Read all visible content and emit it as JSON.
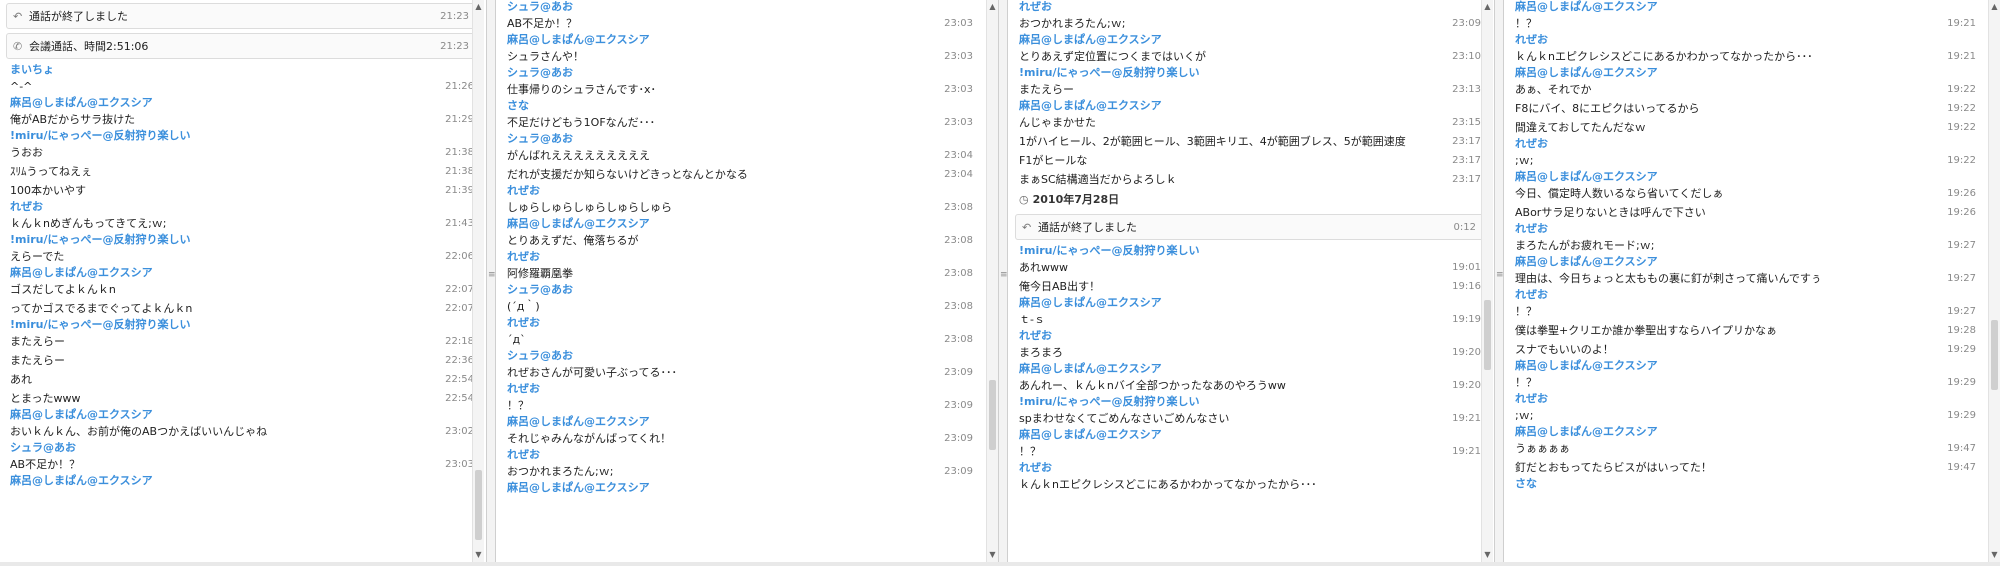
{
  "icons": {
    "call_end": "call-end-icon (handset)",
    "call": "phone-icon",
    "clock": "clock-icon",
    "splitter": "splitter-grip-icon"
  },
  "colors": {
    "name": "#3b8fdc",
    "time": "#8a8a8a",
    "text": "#1e1e1e"
  },
  "columns": [
    {
      "items": [
        {
          "type": "call",
          "icon": "↶",
          "text": "通話が終了しました",
          "time": "21:23"
        },
        {
          "type": "call",
          "icon": "✆",
          "text": "会議通話、時間2:51:06",
          "time": "21:23"
        },
        {
          "type": "msg",
          "name": "まいちょ",
          "lines": [
            {
              "text": "^-^",
              "time": "21:26"
            }
          ]
        },
        {
          "type": "msg",
          "name": "麻呂@しまぱん@エクスシア",
          "lines": [
            {
              "text": "俺がABだからサラ抜けた",
              "time": "21:29"
            }
          ]
        },
        {
          "type": "msg",
          "name": "!miru/にゃっぺー@反射狩り楽しい",
          "lines": [
            {
              "text": "うおお",
              "time": "21:38"
            },
            {
              "text": "ｽﾘﾑうってねえぇ",
              "time": "21:38"
            },
            {
              "text": "100本かいやす",
              "time": "21:39"
            }
          ]
        },
        {
          "type": "msg",
          "name": "れぜお",
          "lines": [
            {
              "text": "ｋんｋnめぎんもってきてえ;ｗ;",
              "time": "21:43"
            }
          ]
        },
        {
          "type": "msg",
          "name": "!miru/にゃっぺー@反射狩り楽しい",
          "lines": [
            {
              "text": "えらーでた",
              "time": "22:06"
            }
          ]
        },
        {
          "type": "msg",
          "name": "麻呂@しまぱん@エクスシア",
          "lines": [
            {
              "text": "ゴスだしてよｋんｋn",
              "time": "22:07"
            },
            {
              "text": "ってかゴスでるまでぐってよｋんｋn",
              "time": "22:07"
            }
          ]
        },
        {
          "type": "msg",
          "name": "!miru/にゃっぺー@反射狩り楽しい",
          "lines": [
            {
              "text": "またえらー",
              "time": "22:18"
            },
            {
              "text": "またえらー",
              "time": "22:36"
            },
            {
              "text": "あれ",
              "time": "22:54"
            },
            {
              "text": "とまったwww",
              "time": "22:54"
            }
          ]
        },
        {
          "type": "msg",
          "name": "麻呂@しまぱん@エクスシア",
          "lines": [
            {
              "text": "おいｋんｋん、お前が俺のABつかえばいいんじゃね",
              "time": "23:02"
            }
          ]
        },
        {
          "type": "msg",
          "name": "シュラ@あお",
          "lines": [
            {
              "text": "AB不足か！？",
              "time": "23:03"
            }
          ]
        },
        {
          "type": "msg",
          "name": "麻呂@しまぱん@エクスシア",
          "lines": []
        }
      ]
    },
    {
      "items": [
        {
          "type": "msg",
          "name": "シュラ@あお",
          "lines": [
            {
              "text": "AB不足か！？",
              "time": "23:03"
            }
          ]
        },
        {
          "type": "msg",
          "name": "麻呂@しまぱん@エクスシア",
          "lines": [
            {
              "text": "シュラさんや！",
              "time": "23:03"
            }
          ]
        },
        {
          "type": "msg",
          "name": "シュラ@あお",
          "lines": [
            {
              "text": "仕事帰りのシュラさんです･x･",
              "time": "23:03"
            }
          ]
        },
        {
          "type": "msg",
          "name": "さな",
          "lines": [
            {
              "text": "不足だけどもう1OFなんだ･･･",
              "time": "23:03"
            }
          ]
        },
        {
          "type": "msg",
          "name": "シュラ@あお",
          "lines": [
            {
              "text": "がんばれえええええええええ",
              "time": "23:04"
            },
            {
              "text": "だれが支援だか知らないけどきっとなんとかなる",
              "time": "23:04"
            }
          ]
        },
        {
          "type": "msg",
          "name": "れぜお",
          "lines": [
            {
              "text": "しゅらしゅらしゅらしゅらしゅら",
              "time": "23:08"
            }
          ]
        },
        {
          "type": "msg",
          "name": "麻呂@しまぱん@エクスシア",
          "lines": [
            {
              "text": "とりあえずだ、俺落ちるが",
              "time": "23:08"
            }
          ]
        },
        {
          "type": "msg",
          "name": "れぜお",
          "lines": [
            {
              "text": "阿修羅覇凰拳",
              "time": "23:08"
            }
          ]
        },
        {
          "type": "msg",
          "name": "シュラ@あお",
          "lines": [
            {
              "text": "(´д｀)",
              "time": "23:08"
            }
          ]
        },
        {
          "type": "msg",
          "name": "れぜお",
          "lines": [
            {
              "text": "´д`",
              "time": "23:08"
            }
          ]
        },
        {
          "type": "msg",
          "name": "シュラ@あお",
          "lines": [
            {
              "text": "れぜおさんが可愛い子ぶってる･･･",
              "time": "23:09"
            }
          ]
        },
        {
          "type": "msg",
          "name": "れぜお",
          "lines": [
            {
              "text": "！？",
              "time": "23:09"
            }
          ]
        },
        {
          "type": "msg",
          "name": "麻呂@しまぱん@エクスシア",
          "lines": [
            {
              "text": "それじゃみんながんばってくれ！",
              "time": "23:09"
            }
          ]
        },
        {
          "type": "msg",
          "name": "れぜお",
          "lines": [
            {
              "text": "おつかれまろたん;ｗ;",
              "time": "23:09"
            }
          ]
        },
        {
          "type": "msg",
          "name": "麻呂@しまぱん@エクスシア",
          "lines": []
        }
      ]
    },
    {
      "items": [
        {
          "type": "msg",
          "name": "れぜお",
          "lines": [
            {
              "text": "おつかれまろたん;ｗ;",
              "time": "23:09"
            }
          ]
        },
        {
          "type": "msg",
          "name": "麻呂@しまぱん@エクスシア",
          "lines": [
            {
              "text": "とりあえず定位置につくまではいくが",
              "time": "23:10"
            }
          ]
        },
        {
          "type": "msg",
          "name": "!miru/にゃっぺー@反射狩り楽しい",
          "lines": [
            {
              "text": "またえらー",
              "time": "23:13"
            }
          ]
        },
        {
          "type": "msg",
          "name": "麻呂@しまぱん@エクスシア",
          "lines": [
            {
              "text": "んじゃまかせた",
              "time": "23:15"
            },
            {
              "text": "1がハイヒール、2が範囲ヒール、3範囲キリエ、4が範囲ブレス、5が範囲速度",
              "time": "23:17"
            },
            {
              "text": "F1がヒールな",
              "time": "23:17"
            },
            {
              "text": "まぁSC結構適当だからよろしｋ",
              "time": "23:17"
            }
          ]
        },
        {
          "type": "date",
          "icon": "◷",
          "text": "2010年7月28日"
        },
        {
          "type": "call",
          "icon": "↶",
          "text": "通話が終了しました",
          "time": "0:12"
        },
        {
          "type": "msg",
          "name": "!miru/にゃっぺー@反射狩り楽しい",
          "lines": [
            {
              "text": "あれwww",
              "time": "19:01"
            },
            {
              "text": "俺今日AB出す！",
              "time": "19:16"
            }
          ]
        },
        {
          "type": "msg",
          "name": "麻呂@しまぱん@エクスシア",
          "lines": [
            {
              "text": "ｔ-ｓ",
              "time": "19:19"
            }
          ]
        },
        {
          "type": "msg",
          "name": "れぜお",
          "lines": [
            {
              "text": "まろまろ",
              "time": "19:20"
            }
          ]
        },
        {
          "type": "msg",
          "name": "麻呂@しまぱん@エクスシア",
          "lines": [
            {
              "text": "あんれー、ｋんｋnバイ全部つかったなあのやろうww",
              "time": "19:20"
            }
          ]
        },
        {
          "type": "msg",
          "name": "!miru/にゃっぺー@反射狩り楽しい",
          "lines": [
            {
              "text": "spまわせなくてごめんなさいごめんなさい",
              "time": "19:21"
            }
          ]
        },
        {
          "type": "msg",
          "name": "麻呂@しまぱん@エクスシア",
          "lines": [
            {
              "text": "！？",
              "time": "19:21"
            }
          ]
        },
        {
          "type": "msg",
          "name": "れぜお",
          "lines": [
            {
              "text": "ｋんｋnエピクレシスどこにあるかわかってなかったから･･･",
              "time": ""
            }
          ]
        }
      ]
    },
    {
      "items": [
        {
          "type": "msg",
          "name": "麻呂@しまぱん@エクスシア",
          "lines": [
            {
              "text": "！？",
              "time": "19:21"
            }
          ]
        },
        {
          "type": "msg",
          "name": "れぜお",
          "lines": [
            {
              "text": "ｋんｋnエピクレシスどこにあるかわかってなかったから･･･",
              "time": "19:21"
            }
          ]
        },
        {
          "type": "msg",
          "name": "麻呂@しまぱん@エクスシア",
          "lines": [
            {
              "text": "あぁ、それでか",
              "time": "19:22"
            },
            {
              "text": "F8にバイ、8にエピクはいってるから",
              "time": "19:22"
            },
            {
              "text": "間違えておしてたんだなｗ",
              "time": "19:22"
            }
          ]
        },
        {
          "type": "msg",
          "name": "れぜお",
          "lines": [
            {
              "text": ";ｗ;",
              "time": "19:22"
            }
          ]
        },
        {
          "type": "msg",
          "name": "麻呂@しまぱん@エクスシア",
          "lines": [
            {
              "text": "今日、償定時人数いるなら省いてくだしぁ",
              "time": "19:26"
            },
            {
              "text": "ABorサラ足りないときは呼んで下さい",
              "time": "19:26"
            }
          ]
        },
        {
          "type": "msg",
          "name": "れぜお",
          "lines": [
            {
              "text": "まろたんがお疲れモード;ｗ;",
              "time": "19:27"
            }
          ]
        },
        {
          "type": "msg",
          "name": "麻呂@しまぱん@エクスシア",
          "lines": [
            {
              "text": "理由は、今日ちょっと太ももの裏に釘が刺さって痛いんですぅ",
              "time": "19:27"
            }
          ]
        },
        {
          "type": "msg",
          "name": "れぜお",
          "lines": [
            {
              "text": "！？",
              "time": "19:27"
            },
            {
              "text": "僕は拳聖+クリエか誰か拳聖出すならハイプリかなぁ",
              "time": "19:28"
            },
            {
              "text": "スナでもいいのよ！",
              "time": "19:29"
            }
          ]
        },
        {
          "type": "msg",
          "name": "麻呂@しまぱん@エクスシア",
          "lines": [
            {
              "text": "！？",
              "time": "19:29"
            }
          ]
        },
        {
          "type": "msg",
          "name": "れぜお",
          "lines": [
            {
              "text": ";ｗ;",
              "time": "19:29"
            }
          ]
        },
        {
          "type": "msg",
          "name": "麻呂@しまぱん@エクスシア",
          "lines": [
            {
              "text": "うぁぁぁぁ",
              "time": "19:47"
            },
            {
              "text": "釘だとおもってたらビスがはいってた！",
              "time": "19:47"
            }
          ]
        },
        {
          "type": "msg",
          "name": "さな",
          "lines": []
        }
      ]
    }
  ]
}
